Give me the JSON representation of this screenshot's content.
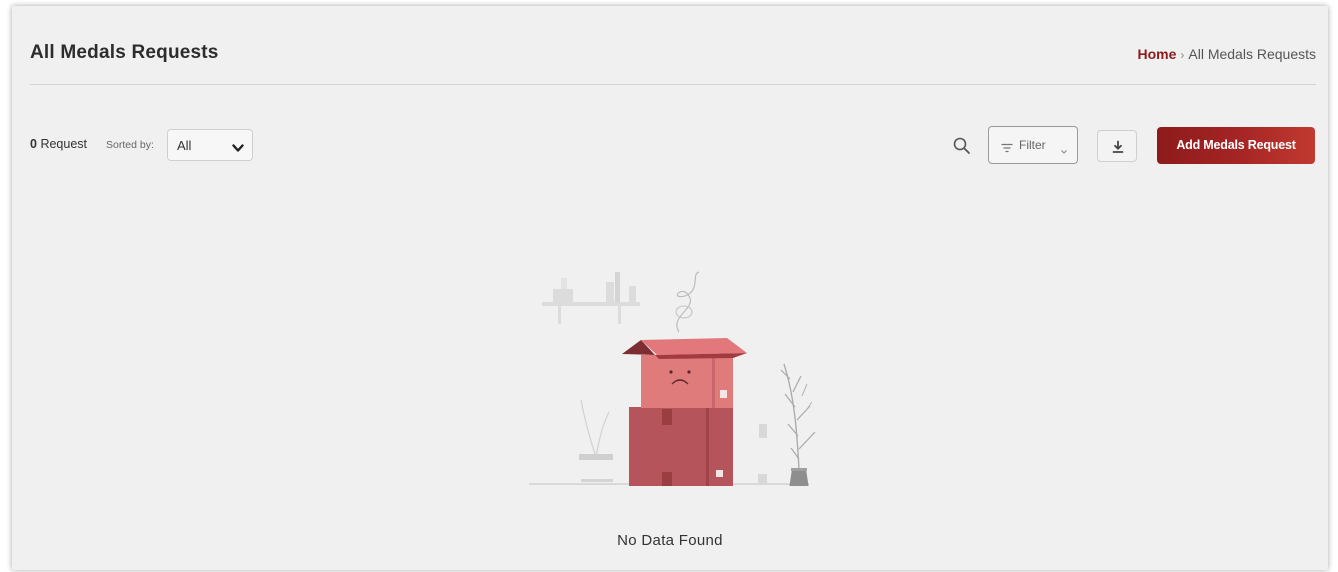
{
  "header": {
    "title": "All Medals Requests",
    "breadcrumb": {
      "home": "Home",
      "separator": "›",
      "current": "All Medals Requests"
    }
  },
  "toolbar": {
    "count_number": "0",
    "count_label": "Request",
    "sorted_label": "Sorted by:",
    "sort_value": "All",
    "filter_label": "Filter",
    "add_label": "Add Medals Request",
    "icons": {
      "search": "search-icon",
      "filter": "filter-lines-icon",
      "download": "download-icon"
    }
  },
  "empty_state": {
    "message": "No Data Found",
    "illustration": "sad-box-illustration"
  },
  "colors": {
    "accent": "#8b1c1c",
    "button_gradient_start": "#8e1b1b",
    "button_gradient_end": "#c13a30",
    "box_top": "#e07b7b",
    "box_bottom": "#b5545a",
    "background": "#f0f0f0"
  }
}
